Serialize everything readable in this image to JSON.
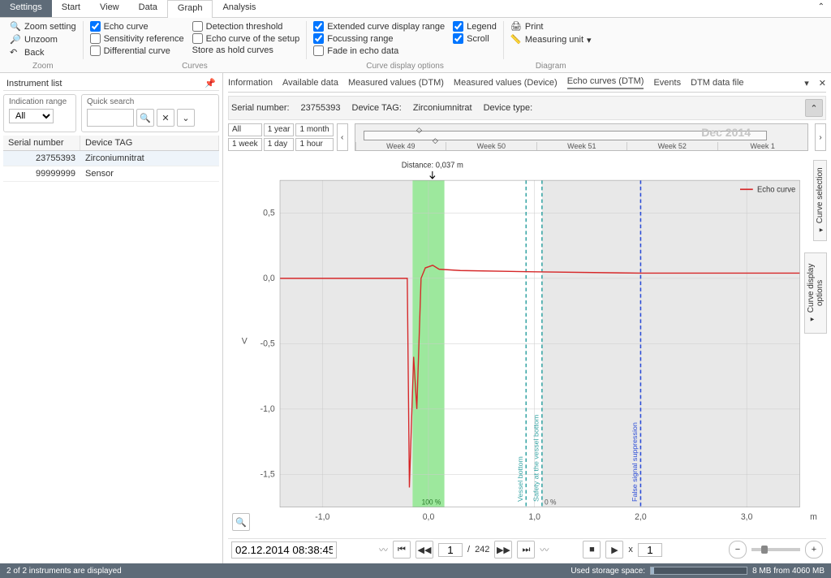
{
  "tabs": {
    "settings": "Settings",
    "start": "Start",
    "view": "View",
    "data": "Data",
    "graph": "Graph",
    "analysis": "Analysis"
  },
  "ribbon": {
    "zoom": {
      "zoom_setting": "Zoom setting",
      "unzoom": "Unzoom",
      "back": "Back",
      "label": "Zoom"
    },
    "curves": {
      "echo": "Echo curve",
      "sens": "Sensitivity reference",
      "diff": "Differential curve",
      "det": "Detection threshold",
      "setup": "Echo curve of the setup",
      "hold": "Store as hold curves",
      "label": "Curves"
    },
    "disp": {
      "ext": "Extended curve display range",
      "focus": "Focussing range",
      "fade": "Fade in echo data",
      "legend": "Legend",
      "scroll": "Scroll",
      "label": "Curve display options"
    },
    "diag": {
      "print": "Print",
      "unit": "Measuring unit",
      "label": "Diagram"
    }
  },
  "left": {
    "panel_title": "Instrument list",
    "ind_legend": "Indication range",
    "ind_value": "All",
    "qs_legend": "Quick search",
    "col_sn": "Serial number",
    "col_tag": "Device TAG",
    "rows": [
      {
        "sn": "23755393",
        "tag": "Zirconiumnitrat"
      },
      {
        "sn": "99999999",
        "tag": "Sensor"
      }
    ]
  },
  "subtabs": {
    "info": "Information",
    "avail": "Available data",
    "mv_dtm": "Measured values (DTM)",
    "mv_dev": "Measured values (Device)",
    "echo": "Echo curves (DTM)",
    "events": "Events",
    "dtmfile": "DTM data file"
  },
  "hdr": {
    "sn_lbl": "Serial number:",
    "sn": "23755393",
    "tag_lbl": "Device TAG:",
    "tag": "Zirconiumnitrat",
    "type_lbl": "Device type:"
  },
  "time": {
    "all": "All",
    "year": "1 year",
    "month": "1 month",
    "week": "1 week",
    "day": "1 day",
    "hour": "1 hour",
    "dec": "Dec 2014",
    "w49": "Week 49",
    "w50": "Week 50",
    "w51": "Week 51",
    "w52": "Week 52",
    "w1": "Week 1"
  },
  "chart_data": {
    "type": "line",
    "title": "",
    "xlabel": "m",
    "ylabel": "V",
    "xlim": [
      -1.4,
      3.5
    ],
    "ylim": [
      -1.75,
      0.75
    ],
    "distance_marker": {
      "label": "Distance: 0,037 m",
      "x": 0.037
    },
    "series": [
      {
        "name": "Echo curve",
        "color": "#d62728"
      }
    ],
    "y_ticks": [
      0.5,
      0.0,
      -0.5,
      -1.0,
      -1.5
    ],
    "x_ticks": [
      -1.0,
      0.0,
      1.0,
      2.0,
      3.0
    ],
    "focus_band": {
      "x0": -0.15,
      "x1": 0.15,
      "color": "#9de89d",
      "label": "100 %"
    },
    "markers": [
      {
        "label": "Vessel bottom",
        "x": 0.92,
        "color": "#3aa6a6",
        "dash": true
      },
      {
        "label": "Safety at the vessel bottom",
        "x": 1.07,
        "color": "#3aa6a6",
        "dash": true,
        "band_label": "0 %"
      },
      {
        "label": "False signal suppression",
        "x": 2.0,
        "color": "#2a4bd7",
        "dash": true
      }
    ],
    "data_points": [
      {
        "x": -1.4,
        "y": 0.0
      },
      {
        "x": -0.2,
        "y": 0.0
      },
      {
        "x": -0.18,
        "y": -1.6
      },
      {
        "x": -0.14,
        "y": -0.6
      },
      {
        "x": -0.11,
        "y": -1.0
      },
      {
        "x": -0.07,
        "y": 0.0
      },
      {
        "x": -0.03,
        "y": 0.08
      },
      {
        "x": 0.04,
        "y": 0.1
      },
      {
        "x": 0.1,
        "y": 0.07
      },
      {
        "x": 0.3,
        "y": 0.06
      },
      {
        "x": 1.0,
        "y": 0.05
      },
      {
        "x": 2.0,
        "y": 0.04
      },
      {
        "x": 3.5,
        "y": 0.04
      }
    ]
  },
  "legend": {
    "echo": "Echo curve"
  },
  "sidepanels": {
    "sel": "Curve selection",
    "opt": "Curve display options"
  },
  "player": {
    "timestamp": "02.12.2014 08:38:45",
    "pos": "1",
    "total": "242",
    "zoom": "1"
  },
  "status": {
    "left": "2 of 2 instruments are displayed",
    "storage_lbl": "Used storage space:",
    "storage_val": "8 MB from 4060 MB"
  }
}
